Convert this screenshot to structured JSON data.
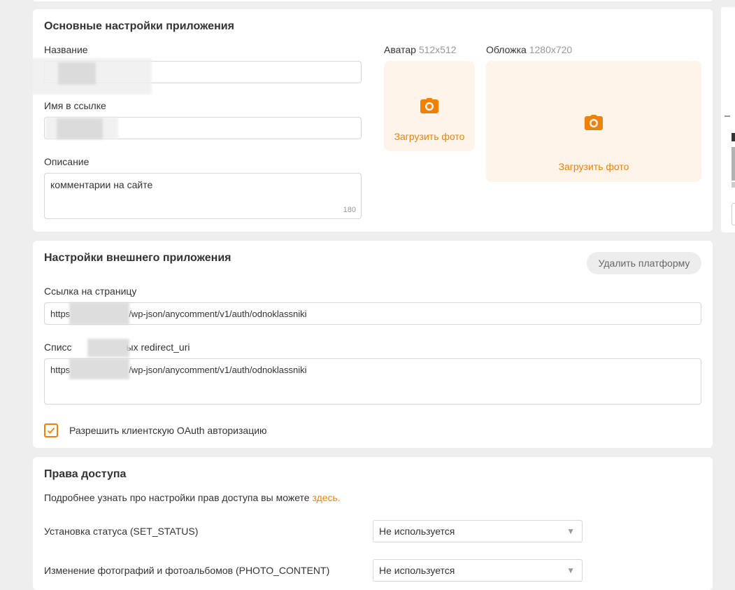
{
  "main": {
    "title": "Основные настройки приложения",
    "name_label": "Название",
    "name_value": "",
    "link_name_label": "Имя в ссылке",
    "link_name_value": "",
    "description_label": "Описание",
    "description_value": "комментарии на сайте",
    "description_counter": "180",
    "avatar_label": "Аватар",
    "avatar_size": "512x512",
    "cover_label": "Обложка",
    "cover_size": "1280x720",
    "upload_label": "Загрузить фото"
  },
  "external": {
    "title": "Настройки внешнего приложения",
    "delete_button": "Удалить платформу",
    "page_link_label": "Ссылка на страницу",
    "page_link_prefix": "https",
    "page_link_suffix": "/wp-json/anycomment/v1/auth/odnoklassniki",
    "redirect_label_prefix": "Списс",
    "redirect_label_suffix": "ых redirect_uri",
    "redirect_prefix": "https",
    "redirect_suffix": "/wp-json/anycomment/v1/auth/odnoklassniki",
    "oauth_label": "Разрешить клиентскую OAuth авторизацию",
    "oauth_checked": true
  },
  "access": {
    "title": "Права доступа",
    "info_text": "Подробнее узнать про настройки прав доступа вы можете ",
    "info_link": "здесь.",
    "permissions": [
      {
        "label": "Установка статуса (SET_STATUS)",
        "value": "Не используется"
      },
      {
        "label": "Изменение фотографий и фотоальбомов (PHOTO_CONTENT)",
        "value": "Не используется"
      }
    ]
  },
  "colors": {
    "accent": "#ee8208",
    "upload_bg": "#fff4ea",
    "page_bg": "#eeeeee"
  },
  "icons": {
    "camera": "camera-icon",
    "dropdown": "triangle-down-icon",
    "check": "check-icon"
  }
}
